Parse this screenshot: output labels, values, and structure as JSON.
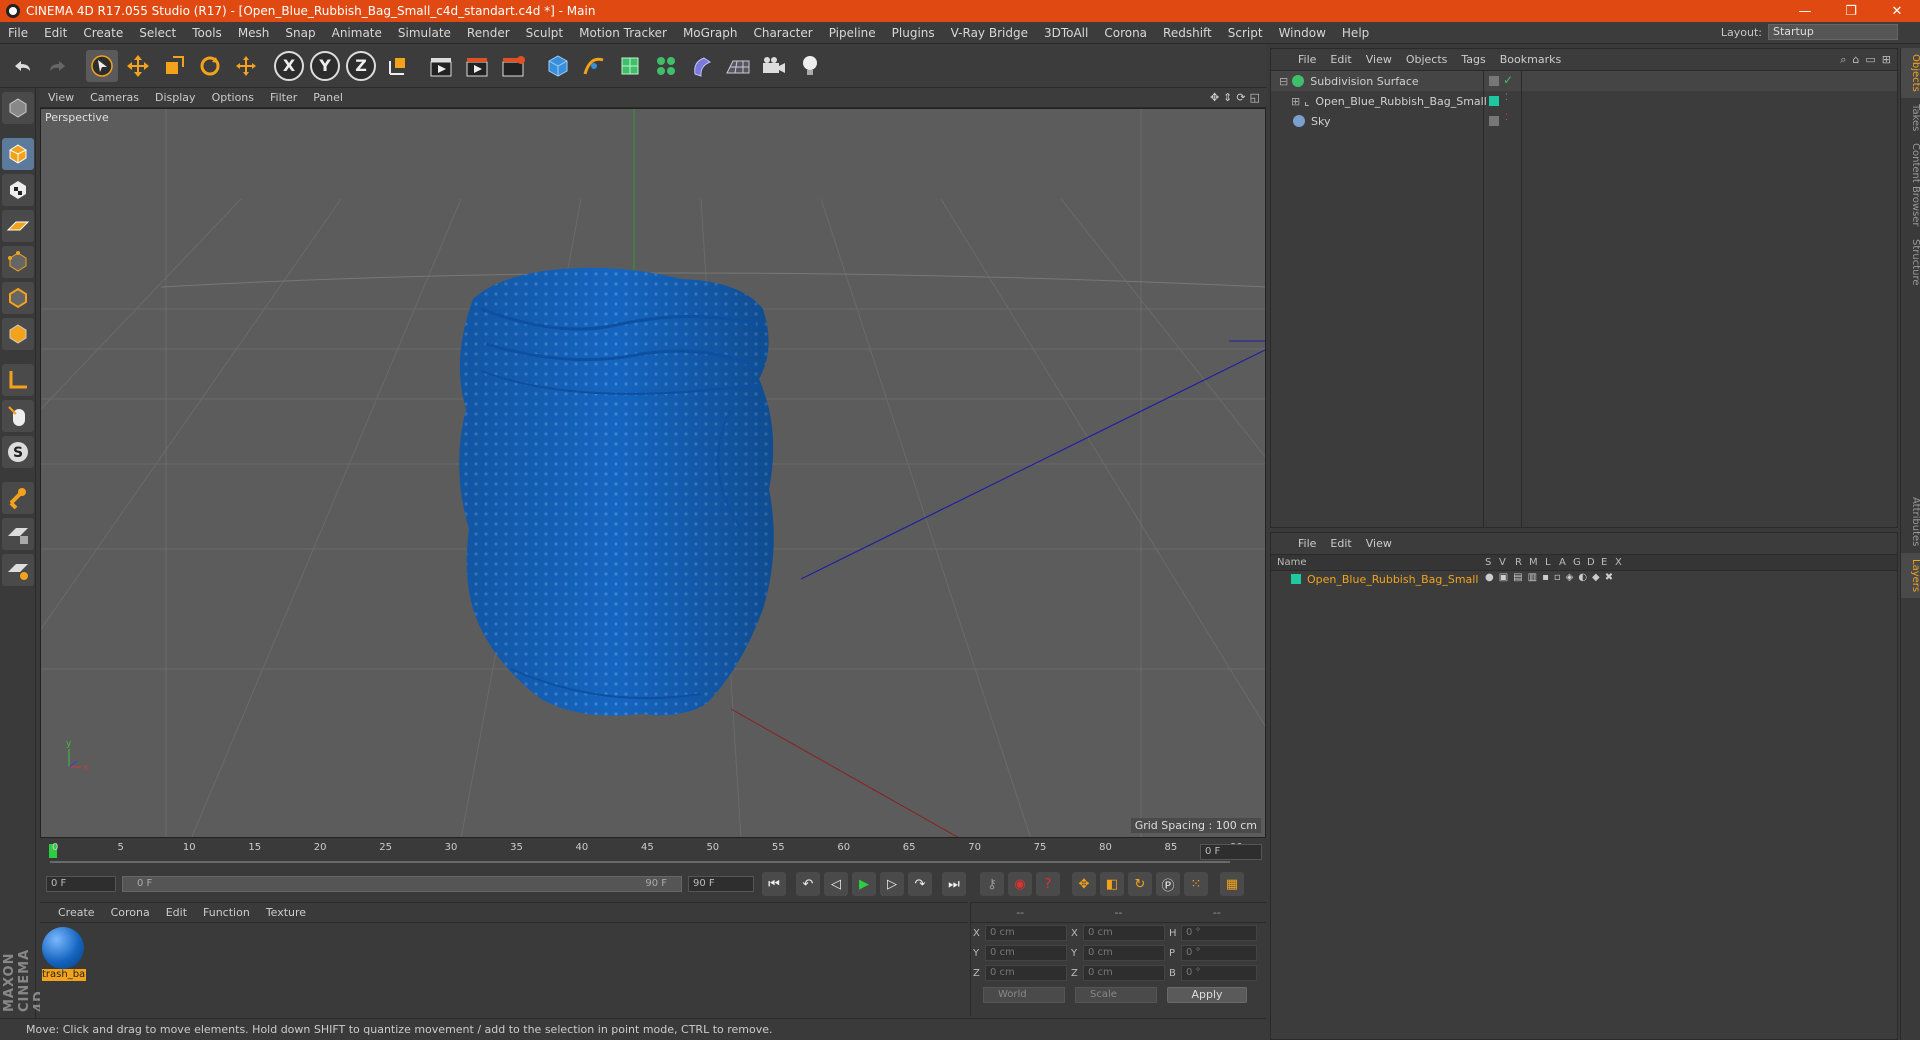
{
  "window": {
    "title": "CINEMA 4D R17.055 Studio (R17) - [Open_Blue_Rubbish_Bag_Small_c4d_standart.c4d *] - Main",
    "minimize": "—",
    "maximize": "❐",
    "close": "✕"
  },
  "menu": [
    "File",
    "Edit",
    "Create",
    "Select",
    "Tools",
    "Mesh",
    "Snap",
    "Animate",
    "Simulate",
    "Render",
    "Sculpt",
    "Motion Tracker",
    "MoGraph",
    "Character",
    "Pipeline",
    "Plugins",
    "V-Ray Bridge",
    "3DToAll",
    "Corona",
    "Redshift",
    "Script",
    "Window",
    "Help"
  ],
  "layout": {
    "label": "Layout:",
    "value": "Startup"
  },
  "toolbar": {
    "axis_x": "X",
    "axis_y": "Y",
    "axis_z": "Z"
  },
  "viewport": {
    "menu": [
      "View",
      "Cameras",
      "Display",
      "Options",
      "Filter",
      "Panel"
    ],
    "label": "Perspective",
    "grid_spacing": "Grid Spacing : 100 cm"
  },
  "timeline": {
    "ticks": [
      "0",
      "5",
      "10",
      "15",
      "20",
      "25",
      "30",
      "35",
      "40",
      "45",
      "50",
      "55",
      "60",
      "65",
      "70",
      "75",
      "80",
      "85",
      "90"
    ],
    "current_frame": "0 F",
    "start_field": "0 F",
    "range_start": "0 F",
    "range_end": "90 F",
    "end_field": "90 F"
  },
  "material": {
    "menu": [
      "Create",
      "Corona",
      "Edit",
      "Function",
      "Texture"
    ],
    "name": "trash_ba"
  },
  "coords": {
    "headers": [
      "--",
      "--",
      "--"
    ],
    "rows": [
      {
        "a1": "X",
        "v1": "0 cm",
        "a2": "X",
        "v2": "0 cm",
        "a3": "H",
        "v3": "0 °"
      },
      {
        "a1": "Y",
        "v1": "0 cm",
        "a2": "Y",
        "v2": "0 cm",
        "a3": "P",
        "v3": "0 °"
      },
      {
        "a1": "Z",
        "v1": "0 cm",
        "a2": "Z",
        "v2": "0 cm",
        "a3": "B",
        "v3": "0 °"
      }
    ],
    "world": "World",
    "scale": "Scale",
    "apply": "Apply"
  },
  "status": "Move: Click and drag to move elements. Hold down SHIFT to quantize movement / add to the selection in point mode, CTRL to remove.",
  "object_manager": {
    "menu": [
      "File",
      "Edit",
      "View",
      "Objects",
      "Tags",
      "Bookmarks"
    ],
    "objects": [
      {
        "name": "Subdivision Surface",
        "color": "#3fbf6a"
      },
      {
        "name": "Open_Blue_Rubbish_Bag_Small",
        "color": "#cfcfcf"
      },
      {
        "name": "Sky",
        "color": "#7aa0d0"
      }
    ]
  },
  "layer_manager": {
    "menu": [
      "File",
      "Edit",
      "View"
    ],
    "columns": [
      "Name",
      "S",
      "V",
      "R",
      "M",
      "L",
      "A",
      "G",
      "D",
      "E",
      "X"
    ],
    "layer": "Open_Blue_Rubbish_Bag_Small",
    "layer_color": "#1ec9a0"
  },
  "side_tabs": [
    "Objects",
    "Takes",
    "Content Browser",
    "Structure",
    "Attributes",
    "Layers"
  ],
  "brand": "MAXON CINEMA 4D",
  "colors": {
    "title_bar": "#e04a12",
    "accent": "#f2a31b",
    "bag": "#1565c0"
  }
}
